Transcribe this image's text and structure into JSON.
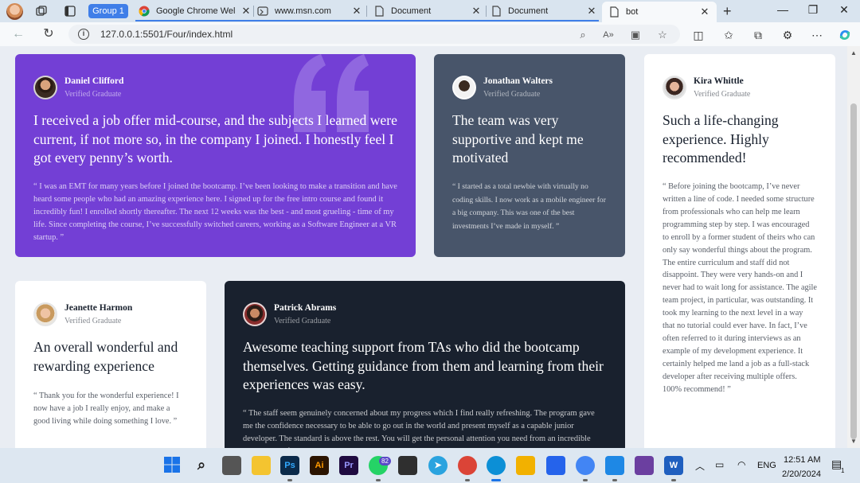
{
  "browser": {
    "tab_group_label": "Group 1",
    "tabs": [
      {
        "title": "Google Chrome Wel"
      },
      {
        "title": "www.msn.com"
      },
      {
        "title": "Document"
      },
      {
        "title": "Document"
      },
      {
        "title": "bot"
      }
    ],
    "address_url": "127.0.0.1:5501/Four/index.html"
  },
  "testimonials": [
    {
      "name": "Daniel Clifford",
      "role": "Verified Graduate",
      "headline": "I received a job offer mid-course, and the subjects I learned were current, if not more so, in the company I joined. I honestly feel I got every penny’s worth.",
      "quote": "“ I was an EMT for many years before I joined the bootcamp. I’ve been looking to make a transition and have heard some people who had an amazing experience here. I signed up for the free intro course and found it incredibly fun! I enrolled shortly thereafter. The next 12 weeks was the best - and most grueling - time of my life. Since completing the course, I’ve successfully switched careers, working as a Software Engineer at a VR startup. ”"
    },
    {
      "name": "Jonathan Walters",
      "role": "Verified Graduate",
      "headline": "The team was very supportive and kept me motivated",
      "quote": "“ I started as a total newbie with virtually no coding skills. I now work as a mobile engineer for a big company. This was one of the best investments I’ve made in myself. ”"
    },
    {
      "name": "Kira Whittle",
      "role": "Verified Graduate",
      "headline": "Such a life-changing experience. Highly recommended!",
      "quote": "“ Before joining the bootcamp, I’ve never written a line of code. I needed some structure from professionals who can help me learn programming step by step. I was encouraged to enroll by a former student of theirs who can only say wonderful things about the program. The entire curriculum and staff did not disappoint. They were very hands-on and I never had to wait long for assistance. The agile team project, in particular, was outstanding. It took my learning to the next level in a way that no tutorial could ever have. In fact, I’ve often referred to it during interviews as an example of my development experience. It certainly helped me land a job as a full-stack developer after receiving multiple offers. 100% recommend! ”"
    },
    {
      "name": "Jeanette Harmon",
      "role": "Verified Graduate",
      "headline": "An overall wonderful and rewarding experience",
      "quote": "“ Thank you for the wonderful experience! I now have a job I really enjoy, and make a good living while doing something I love. ”"
    },
    {
      "name": "Patrick Abrams",
      "role": "Verified Graduate",
      "headline": "Awesome teaching support from TAs who did the bootcamp themselves. Getting guidance from them and learning from their experiences was easy.",
      "quote": "“ The staff seem genuinely concerned about my progress which I find really refreshing. The program gave me the confidence necessary to be able to go out in the world and present myself as a capable junior developer. The standard is above the rest. You will get the personal attention you need from an incredible community of smart and amazing people. ”"
    }
  ],
  "taskbar": {
    "whatsapp_badge": "82",
    "language": "ENG",
    "time": "12:51 AM",
    "date": "2/20/2024",
    "notification_count": "1",
    "apps": [
      {
        "label": "Ps",
        "color": "#0b2a4a",
        "fg": "#31a8ff"
      },
      {
        "label": "Ai",
        "color": "#2b1400",
        "fg": "#ff9a00"
      },
      {
        "label": "Pr",
        "color": "#1f0b40",
        "fg": "#9999ff"
      }
    ]
  },
  "colors": {
    "purple_card": "#733fd5",
    "slate_card": "#48556a",
    "dark_card": "#19212e",
    "white_card": "#ffffff",
    "page_bg": "#e9edf3",
    "tab_group": "#3f7ee8"
  }
}
